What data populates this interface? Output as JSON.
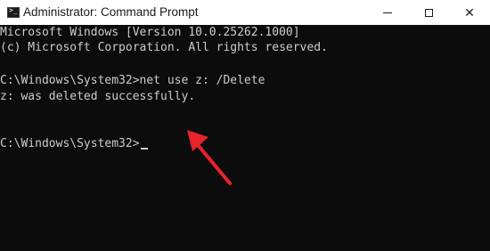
{
  "window": {
    "title": "Administrator: Command Prompt",
    "icons": {
      "app": "command-prompt-icon",
      "minimize": "minimize-icon",
      "maximize": "maximize-icon",
      "close": "close-icon"
    },
    "close_glyph": "✕"
  },
  "terminal": {
    "lines": [
      "Microsoft Windows [Version 10.0.25262.1000]",
      "(c) Microsoft Corporation. All rights reserved.",
      "C:\\Windows\\System32>net use z: /Delete",
      "z: was deleted successfully.",
      "C:\\Windows\\System32>"
    ]
  },
  "annotation": {
    "type": "arrow",
    "color": "#e8232a",
    "points_to": "z: was deleted successfully."
  },
  "colors": {
    "terminal_background": "#0c0c0c",
    "terminal_text": "#cccccc",
    "titlebar_background": "#ffffff"
  }
}
